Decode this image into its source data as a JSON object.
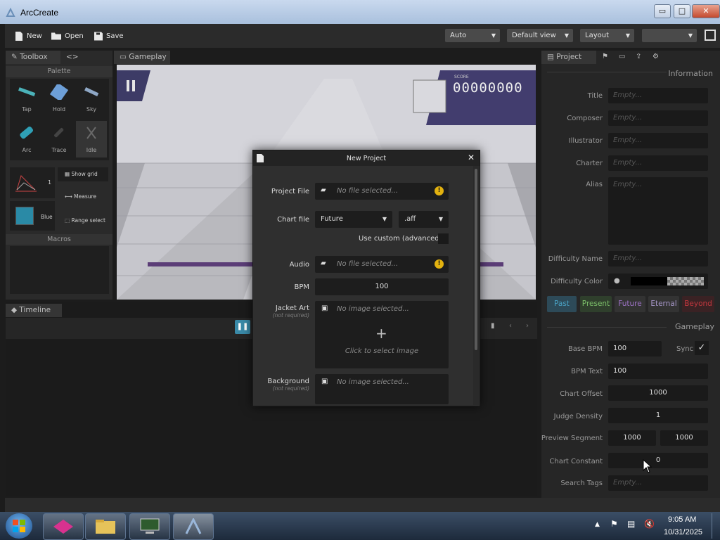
{
  "window": {
    "title": "ArcCreate",
    "minimize": "▭",
    "maximize": "□",
    "close": "✕"
  },
  "toolbar": {
    "new_label": "New",
    "open_label": "Open",
    "save_label": "Save",
    "dropdowns": [
      "Auto",
      "Default view",
      "Layout",
      ""
    ]
  },
  "toolbox": {
    "tab_label": "Toolbox",
    "tab2_label": "<>",
    "palette_header": "Palette",
    "tools": [
      "Tap",
      "Hold",
      "Sky",
      "Arc",
      "Trace",
      "Idle"
    ],
    "widgets": {
      "timing_value": "1",
      "show_grid": "Show grid",
      "measure": "Measure",
      "color_label": "Blue",
      "range_select": "Range select"
    },
    "macros_header": "Macros"
  },
  "gameplay": {
    "tab_label": "Gameplay",
    "score_label": "SCORE",
    "score": "00000000"
  },
  "timeline": {
    "tab_label": "Timeline"
  },
  "dialog": {
    "title": "New Project",
    "close": "✕",
    "project_file_label": "Project File",
    "project_file_value": "No file selected...",
    "chart_file_label": "Chart file",
    "chart_difficulty": "Future",
    "chart_ext": ".aff",
    "use_custom_label": "Use custom (advanced)",
    "audio_label": "Audio",
    "audio_value": "No file selected...",
    "bpm_label": "BPM",
    "bpm_value": "100",
    "jacket_label": "Jacket Art",
    "jacket_sub": "(not required)",
    "jacket_value": "No image selected...",
    "jacket_hint": "Click to select image",
    "plus": "+",
    "background_label": "Background",
    "background_sub": "(not required)",
    "background_value": "No image selected...",
    "warn": "!"
  },
  "project": {
    "tab_label": "Project",
    "information_header": "Information",
    "fields": [
      {
        "label": "Title",
        "value": "Empty..."
      },
      {
        "label": "Composer",
        "value": "Empty..."
      },
      {
        "label": "Illustrator",
        "value": "Empty..."
      },
      {
        "label": "Charter",
        "value": "Empty..."
      },
      {
        "label": "Alias",
        "value": "Empty..."
      },
      {
        "label": "Difficulty Name",
        "value": "Empty..."
      }
    ],
    "difficulty_color_label": "Difficulty Color",
    "difficulties": [
      {
        "label": "Past",
        "color": "#4aa3c5"
      },
      {
        "label": "Present",
        "color": "#7cc06a"
      },
      {
        "label": "Future",
        "color": "#9c72c4"
      },
      {
        "label": "Eternal",
        "color": "#a696c8"
      },
      {
        "label": "Beyond",
        "color": "#c2373e"
      }
    ],
    "gameplay_header": "Gameplay",
    "base_bpm_label": "Base BPM",
    "base_bpm_value": "100",
    "sync_label": "Sync",
    "sync_check": "✓",
    "bpm_text_label": "BPM Text",
    "bpm_text_value": "100",
    "chart_offset_label": "Chart Offset",
    "chart_offset_value": "1000",
    "judge_density_label": "Judge Density",
    "judge_density_value": "1",
    "preview_segment_label": "Preview Segment",
    "preview_start": "1000",
    "preview_end": "1000",
    "chart_constant_label": "Chart Constant",
    "chart_constant_value": "0",
    "search_tags_label": "Search Tags",
    "search_tags_value": "Empty..."
  },
  "taskbar": {
    "time": "9:05 AM",
    "date": "10/31/2025"
  }
}
